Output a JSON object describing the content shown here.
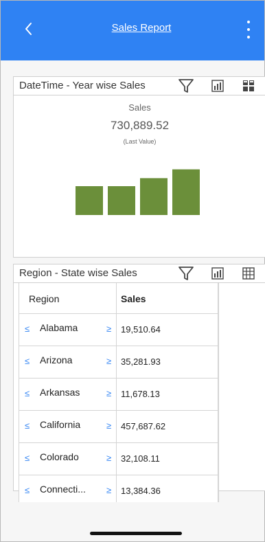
{
  "header": {
    "title": "Sales Report",
    "back_icon": "chevron-left-icon",
    "more_icon": "vertical-ellipsis-icon",
    "bar_color": "#2f82f3"
  },
  "panels": [
    {
      "title": "DateTime - Year wise Sales",
      "icons": [
        "filter-icon",
        "chart-icon",
        "grid-icon"
      ],
      "kpi": {
        "label": "Sales",
        "value": "730,889.52",
        "subtitle": "(Last Value)"
      },
      "chart_data": {
        "type": "bar",
        "title": "",
        "xlabel": "",
        "ylabel": "",
        "categories": [
          "",
          "",
          "",
          ""
        ],
        "values": [
          36,
          36,
          46,
          57
        ],
        "ylim": [
          0,
          60
        ],
        "bar_color": "#6b8f3a",
        "grid": false,
        "legend": "none"
      }
    },
    {
      "title": "Region - State wise Sales",
      "icons": [
        "filter-icon",
        "chart-icon",
        "table-icon"
      ],
      "columns": [
        "Region",
        "Sales"
      ],
      "rows": [
        {
          "region": "Alabama",
          "sales": "19,510.64"
        },
        {
          "region": "Arizona",
          "sales": "35,281.93"
        },
        {
          "region": "Arkansas",
          "sales": "11,678.13"
        },
        {
          "region": "California",
          "sales": "457,687.62"
        },
        {
          "region": "Colorado",
          "sales": "32,108.11"
        },
        {
          "region": "Connecti...",
          "sales": "13,384.36"
        }
      ]
    }
  ]
}
